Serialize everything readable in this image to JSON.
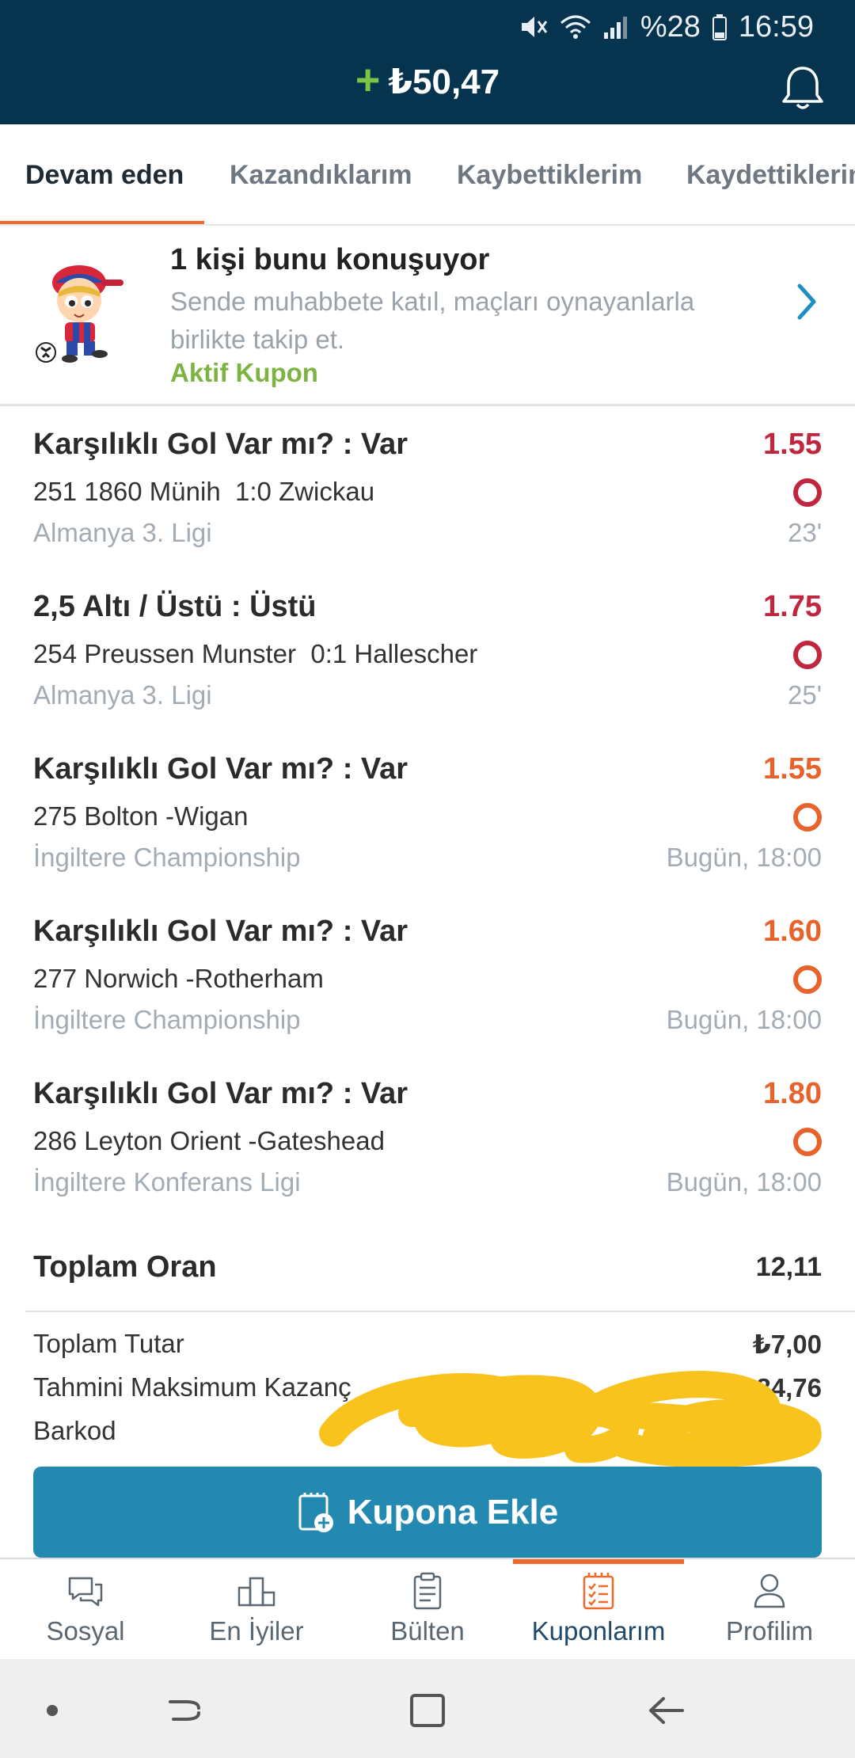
{
  "status_bar": {
    "battery": "%28",
    "time": "16:59"
  },
  "header": {
    "plus": "+",
    "balance": "₺50,47"
  },
  "tabs": [
    {
      "label": "Devam eden",
      "active": true
    },
    {
      "label": "Kazandıklarım",
      "active": false
    },
    {
      "label": "Kaybettiklerim",
      "active": false
    },
    {
      "label": "Kaydettiklerim",
      "active": false
    }
  ],
  "banner": {
    "title": "1 kişi bunu konuşuyor",
    "subtitle": "Sende muhabbete katıl, maçları oynayanlarla birlikte takip et.",
    "link": "Aktif Kupon"
  },
  "bets": [
    {
      "market": "Karşılıklı Gol Var mı? : Var",
      "odd": "1.55",
      "match": "251 1860 Münih  1:0 Zwickau",
      "league": "Almanya 3. Ligi",
      "time": "23'",
      "color": "#c0263e"
    },
    {
      "market": "2,5 Altı / Üstü : Üstü",
      "odd": "1.75",
      "match": "254 Preussen Munster  0:1 Hallescher",
      "league": "Almanya 3. Ligi",
      "time": "25'",
      "color": "#c0263e"
    },
    {
      "market": "Karşılıklı Gol Var mı? : Var",
      "odd": "1.55",
      "match": "275 Bolton -Wigan",
      "league": "İngiltere Championship",
      "time": "Bugün, 18:00",
      "color": "#e8632b"
    },
    {
      "market": "Karşılıklı Gol Var mı? : Var",
      "odd": "1.60",
      "match": "277 Norwich -Rotherham",
      "league": "İngiltere Championship",
      "time": "Bugün, 18:00",
      "color": "#e8632b"
    },
    {
      "market": "Karşılıklı Gol Var mı? : Var",
      "odd": "1.80",
      "match": "286 Leyton Orient -Gateshead",
      "league": "İngiltere Konferans Ligi",
      "time": "Bugün, 18:00",
      "color": "#e8632b"
    }
  ],
  "totals": {
    "total_odds_label": "Toplam Oran",
    "total_odds": "12,11",
    "stake_label": "Toplam Tutar",
    "stake": "₺7,00",
    "max_win_label": "Tahmini Maksimum Kazanç",
    "max_win": "₺84,76",
    "barcode_label": "Barkod"
  },
  "add_button": {
    "label": "Kupona Ekle"
  },
  "bottom_nav": [
    {
      "label": "Sosyal",
      "icon": "chat-icon"
    },
    {
      "label": "En İyiler",
      "icon": "podium-icon"
    },
    {
      "label": "Bülten",
      "icon": "clipboard-icon"
    },
    {
      "label": "Kuponlarım",
      "icon": "coupon-list-icon",
      "active": true
    },
    {
      "label": "Profilim",
      "icon": "profile-icon"
    }
  ],
  "colors": {
    "header_bg": "#06334e",
    "accent_orange": "#ef6a2b",
    "button_blue": "#2389b1",
    "green": "#7cb342",
    "odd_red": "#c0263e",
    "odd_orange": "#e8632b"
  }
}
